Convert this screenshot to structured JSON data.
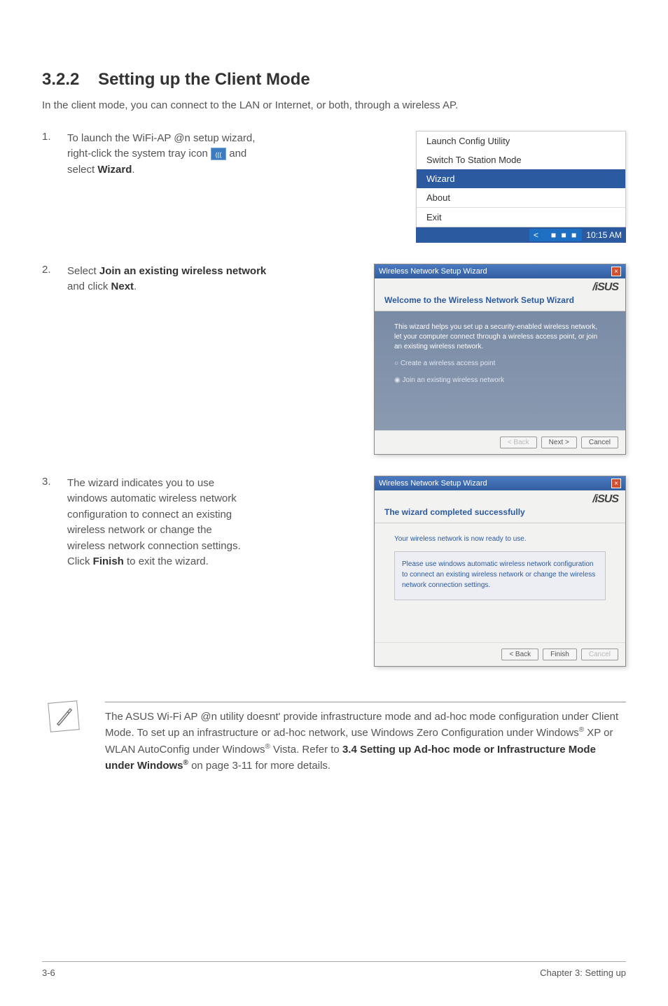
{
  "section": {
    "number": "3.2.2",
    "title": "Setting up the Client Mode"
  },
  "intro": "In the client mode, you can connect to the LAN or Internet, or both, through a wireless AP.",
  "steps": [
    {
      "num": "1.",
      "pre": "To launch the WiFi-AP @n setup wizard, right-click the system tray icon ",
      "post": " and select ",
      "bold": "Wizard",
      "tail": "."
    },
    {
      "num": "2.",
      "pre": "Select ",
      "bold1": "Join an existing wireless network",
      "mid": " and click ",
      "bold2": "Next",
      "tail": "."
    },
    {
      "num": "3.",
      "pre": "The wizard indicates you to use windows automatic wireless network configuration to connect an existing wireless network or change the wireless network connection settings. Click ",
      "bold": "Finish",
      "tail": " to exit the wizard."
    }
  ],
  "contextMenu": {
    "items": [
      "Launch Config Utility",
      "Switch To Station Mode",
      "Wizard",
      "About",
      "Exit"
    ],
    "selectedIndex": 2,
    "time": "10:15 AM"
  },
  "wizard1": {
    "titlebar": "Wireless Network Setup Wizard",
    "brand": "/iSUS",
    "heading": "Welcome to the Wireless Network Setup Wizard",
    "intro": "This wizard helps you set up a security-enabled wireless network, let your computer connect through a wireless access point, or join an existing wireless network.",
    "option1": "Create a wireless access point",
    "option2": "Join an existing wireless network",
    "buttons": {
      "back": "< Back",
      "next": "Next >",
      "cancel": "Cancel"
    }
  },
  "wizard2": {
    "titlebar": "Wireless Network Setup Wizard",
    "brand": "/iSUS",
    "heading": "The wizard completed successfully",
    "line1": "Your wireless network is now ready to use.",
    "box": "Please use windows automatic wireless network configuration to connect an existing wireless network or change the wireless network connection settings.",
    "buttons": {
      "back": "< Back",
      "finish": "Finish",
      "cancel": "Cancel"
    }
  },
  "note": {
    "text1": "The ASUS Wi-Fi AP @n utility doesnt' provide infrastructure mode and ad-hoc mode configuration under Client Mode. To set up an infrastructure or ad-hoc network, use Windows Zero Configuration under Windows",
    "sup1": "®",
    "text2": " XP or WLAN AutoConfig under Windows",
    "sup2": "®",
    "text3": " Vista. Refer to ",
    "bold1": "3.4 Setting up Ad-hoc mode or Infrastructure Mode under Windows",
    "sup3": "®",
    "text4": " on page 3-11 for more details."
  },
  "footer": {
    "left": "3-6",
    "right": "Chapter 3: Setting up"
  }
}
